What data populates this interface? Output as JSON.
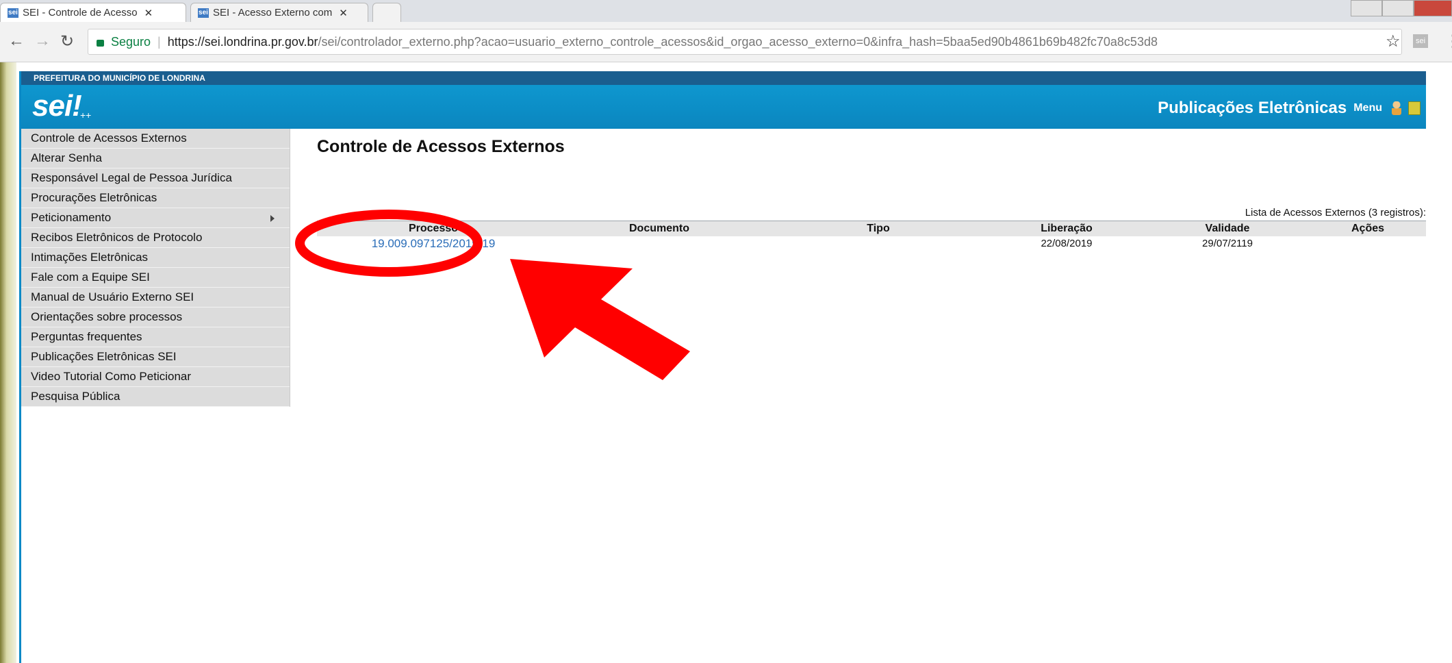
{
  "browser": {
    "tabs": [
      {
        "label": "SEI - Controle de Acesso",
        "favicon": "sei"
      },
      {
        "label": "SEI - Acesso Externo com",
        "favicon": "sei"
      }
    ],
    "security_label": "Seguro",
    "url_host": "https://sei.londrina.pr.gov.br",
    "url_path": "/sei/controlador_externo.php?acao=usuario_externo_controle_acessos&id_orgao_acesso_externo=0&infra_hash=5baa5ed90b4861b69b482fc70a8c53d8",
    "extension_label": "sei"
  },
  "header": {
    "org_name": "PREFEITURA DO MUNICÍPIO DE LONDRINA",
    "logo": "sei!",
    "logo_suffix": "++",
    "title": "Publicações Eletrônicas",
    "menu_label": "Menu"
  },
  "sidebar": {
    "items": [
      {
        "label": "Controle de Acessos Externos"
      },
      {
        "label": "Alterar Senha"
      },
      {
        "label": "Responsável Legal de Pessoa Jurídica"
      },
      {
        "label": "Procurações Eletrônicas"
      },
      {
        "label": "Peticionamento"
      },
      {
        "label": "Recibos Eletrônicos de Protocolo"
      },
      {
        "label": "Intimações Eletrônicas"
      },
      {
        "label": "Fale com a Equipe SEI"
      },
      {
        "label": "Manual de Usuário Externo SEI"
      },
      {
        "label": "Orientações sobre processos"
      },
      {
        "label": "Perguntas frequentes"
      },
      {
        "label": "Publicações Eletrônicas SEI"
      },
      {
        "label": "Video Tutorial Como Peticionar"
      },
      {
        "label": "Pesquisa Pública"
      }
    ]
  },
  "main": {
    "title": "Controle de Acessos Externos",
    "caption": "Lista de Acessos Externos (3 registros):",
    "columns": [
      "Processo",
      "Documento",
      "Tipo",
      "Liberação",
      "Validade",
      "Ações"
    ],
    "rows": [
      {
        "processo": "19.009.097125/2019-19",
        "documento": "",
        "tipo": "",
        "liberacao": "22/08/2019",
        "validade": "29/07/2119",
        "acoes": ""
      }
    ]
  },
  "colors": {
    "header_blue": "#0b86bf",
    "org_bar": "#1a5e8f",
    "annotation_red": "#ff0000",
    "link": "#2a6db8"
  }
}
